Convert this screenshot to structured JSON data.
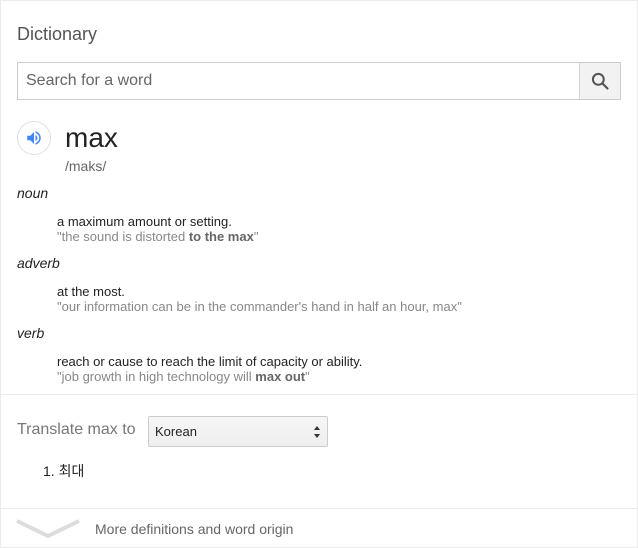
{
  "header": {
    "title": "Dictionary"
  },
  "search": {
    "placeholder": "Search for a word",
    "value": "",
    "icon": "search-icon"
  },
  "entry": {
    "word": "max",
    "phonetic": "/maks/",
    "audio_icon": "speaker-icon",
    "senses": [
      {
        "pos": "noun",
        "definition": "a maximum amount or setting.",
        "example_pre": "\"the sound is distorted ",
        "example_bold": "to the max",
        "example_post": "\""
      },
      {
        "pos": "adverb",
        "definition": "at the most.",
        "example_pre": "\"our information can be in the commander's hand in half an hour, max\"",
        "example_bold": "",
        "example_post": ""
      },
      {
        "pos": "verb",
        "definition": "reach or cause to reach the limit of capacity or ability.",
        "example_pre": "\"job growth in high technology will ",
        "example_bold": "max out",
        "example_post": "\""
      }
    ]
  },
  "translate": {
    "label": "Translate max to",
    "selected_language": "Korean",
    "results": [
      {
        "index": "1.",
        "text": "최대"
      }
    ]
  },
  "footer": {
    "more_label": "More definitions and word origin",
    "chevron_icon": "chevron-down-icon"
  },
  "colors": {
    "accent": "#4285f4",
    "muted": "#888888",
    "border": "#cccccc"
  }
}
